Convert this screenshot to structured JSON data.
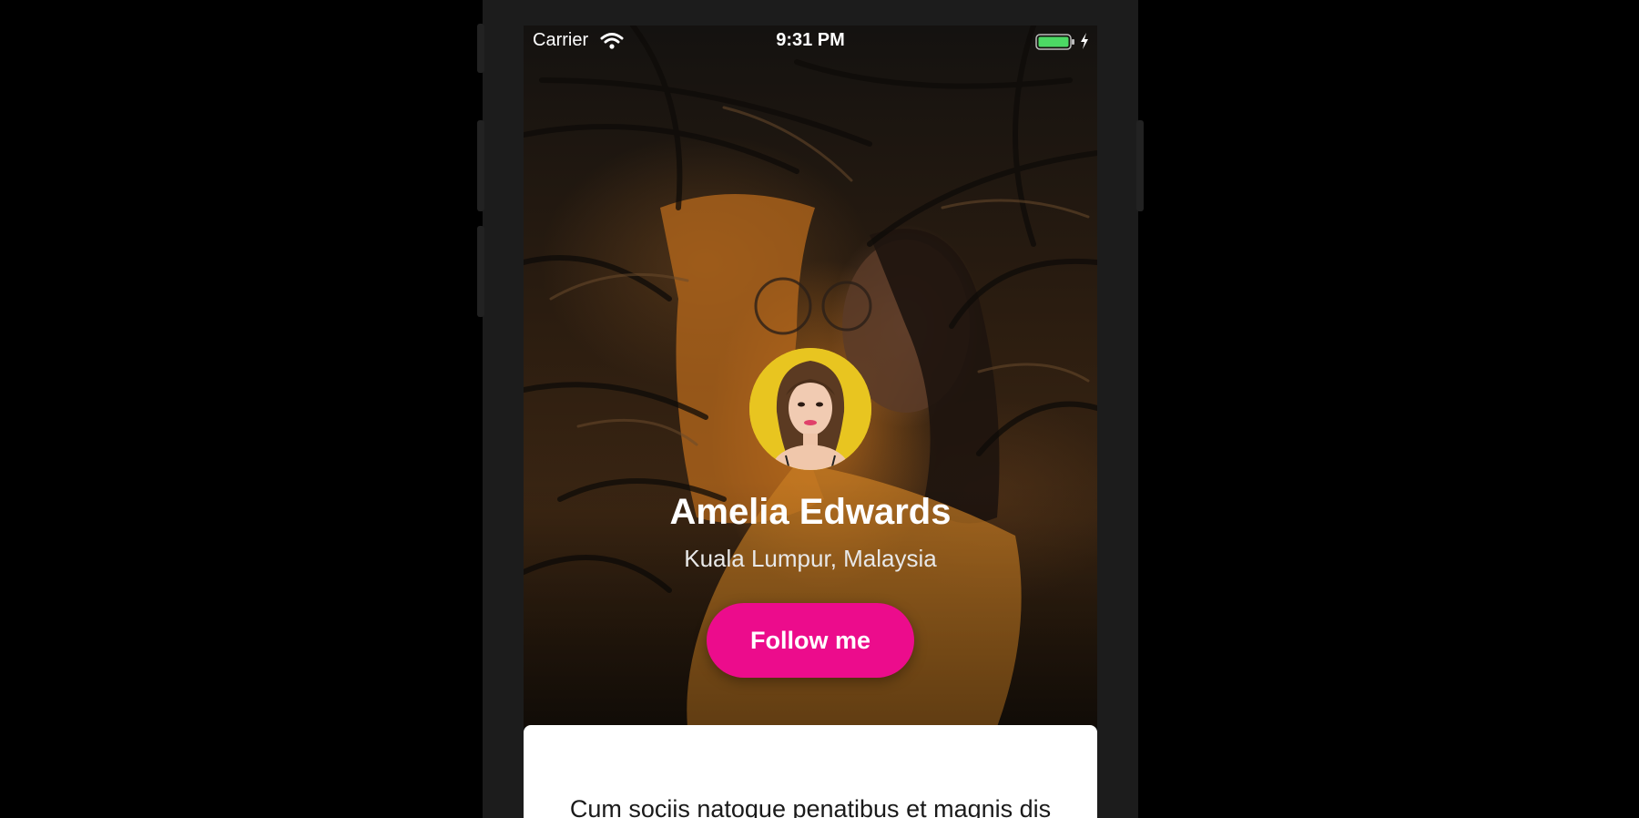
{
  "status_bar": {
    "carrier": "Carrier",
    "time": "9:31 PM"
  },
  "profile": {
    "name": "Amelia Edwards",
    "location": "Kuala Lumpur, Malaysia",
    "follow_label": "Follow me"
  },
  "bio": {
    "text": "Cum sociis natoque penatibus et magnis dis parturient montes, nascetur ridiculus mus."
  },
  "colors": {
    "accent": "#ec0c8c",
    "battery": "#4cd964"
  },
  "icons": [
    "wifi-icon",
    "battery-icon",
    "charging-bolt-icon"
  ]
}
